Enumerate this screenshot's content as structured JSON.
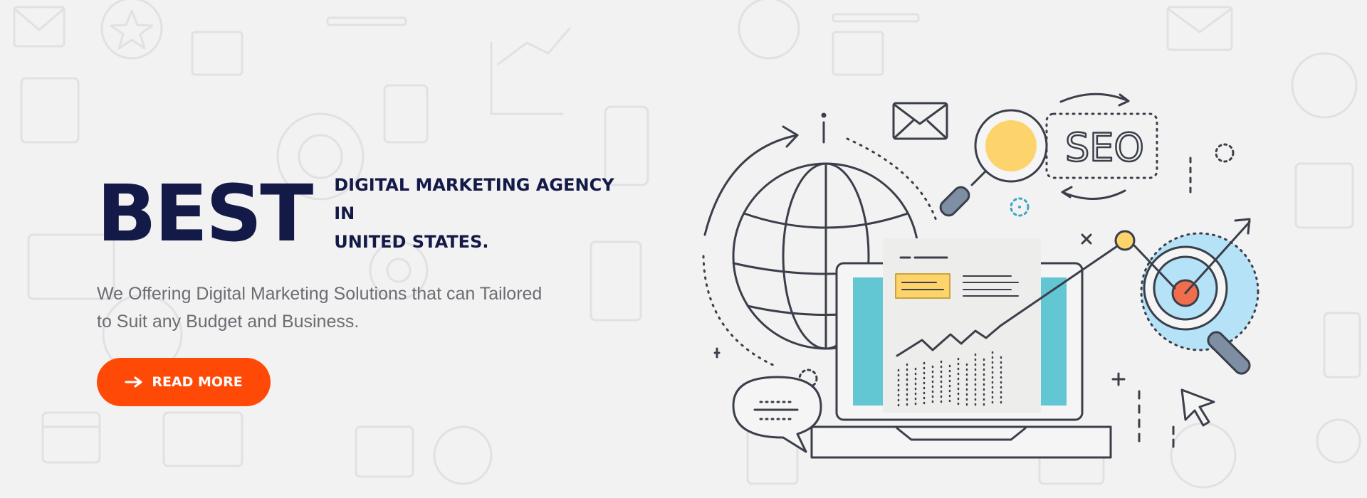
{
  "hero": {
    "headline_big": "BEST",
    "headline_line1": "DIGITAL MARKETING AGENCY IN",
    "headline_line2": "UNITED STATES.",
    "description_line1": "We Offering Digital Marketing Solutions that can Tailored",
    "description_line2": "to Suit any Budget and Business.",
    "cta_label": "READ MORE",
    "cta_icon": "arrow-right-icon"
  },
  "illustration": {
    "seo_label": "SEO",
    "icons": [
      "globe-icon",
      "envelope-icon",
      "magnifier-icon",
      "laptop-icon",
      "chat-bubble-icon",
      "target-magnifier-icon",
      "cursor-icon"
    ]
  },
  "colors": {
    "brand_dark": "#141a47",
    "accent": "#ff4a07",
    "text_muted": "#6c6c72",
    "background": "#f2f2f3",
    "teal": "#62c6d3",
    "yellow": "#fdd36b",
    "light_blue": "#b6e2f8",
    "coral": "#f06e4c"
  }
}
